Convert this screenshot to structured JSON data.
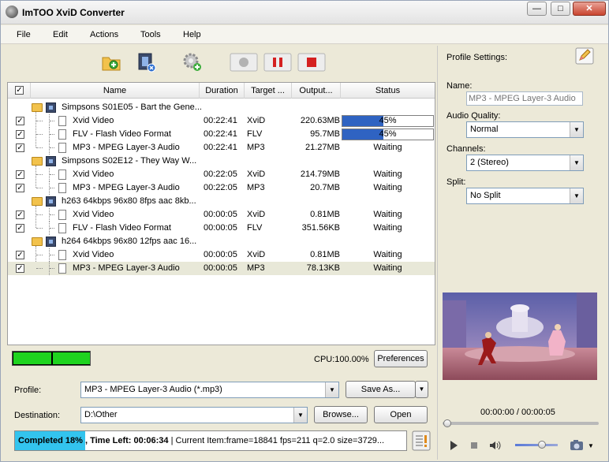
{
  "window": {
    "title": "ImTOO XviD Converter",
    "minimize": "—",
    "maximize": "□",
    "close": "✕"
  },
  "menu": [
    "File",
    "Edit",
    "Actions",
    "Tools",
    "Help"
  ],
  "table": {
    "headers": [
      "Name",
      "Duration",
      "Target ...",
      "Output...",
      "Status"
    ],
    "groups": [
      {
        "name": "Simpsons S01E05 - Bart the Gene...",
        "items": [
          {
            "name": "Xvid Video",
            "duration": "00:22:41",
            "target": "XviD",
            "output": "220.63MB",
            "status": "45%",
            "progress": 45
          },
          {
            "name": "FLV - Flash Video Format",
            "duration": "00:22:41",
            "target": "FLV",
            "output": "95.7MB",
            "status": "45%",
            "progress": 45
          },
          {
            "name": "MP3 - MPEG Layer-3 Audio",
            "duration": "00:22:41",
            "target": "MP3",
            "output": "21.27MB",
            "status": "Waiting"
          }
        ]
      },
      {
        "name": "Simpsons S02E12 - They Way W...",
        "items": [
          {
            "name": "Xvid Video",
            "duration": "00:22:05",
            "target": "XviD",
            "output": "214.79MB",
            "status": "Waiting"
          },
          {
            "name": "MP3 - MPEG Layer-3 Audio",
            "duration": "00:22:05",
            "target": "MP3",
            "output": "20.7MB",
            "status": "Waiting"
          }
        ]
      },
      {
        "name": "h263 64kbps 96x80 8fps aac 8kb...",
        "items": [
          {
            "name": "Xvid Video",
            "duration": "00:00:05",
            "target": "XviD",
            "output": "0.81MB",
            "status": "Waiting"
          },
          {
            "name": "FLV - Flash Video Format",
            "duration": "00:00:05",
            "target": "FLV",
            "output": "351.56KB",
            "status": "Waiting"
          }
        ]
      },
      {
        "name": "h264 64kbps 96x80 12fps aac 16...",
        "items": [
          {
            "name": "Xvid Video",
            "duration": "00:00:05",
            "target": "XviD",
            "output": "0.81MB",
            "status": "Waiting"
          },
          {
            "name": "MP3 - MPEG Layer-3 Audio",
            "duration": "00:00:05",
            "target": "MP3",
            "output": "78.13KB",
            "status": "Waiting",
            "selected": true
          }
        ]
      }
    ]
  },
  "cpu": {
    "label": "CPU:100.00%"
  },
  "buttons": {
    "preferences": "Preferences",
    "save_as": "Save As...",
    "browse": "Browse...",
    "open": "Open"
  },
  "profile": {
    "label": "Profile:",
    "value": "MP3 - MPEG Layer-3 Audio (*.mp3)"
  },
  "destination": {
    "label": "Destination:",
    "value": "D:\\Other"
  },
  "status_bar": {
    "progress": 18,
    "completed": "Completed 18%",
    "time_left": " , Time Left: 00:06:34",
    "current": " | Current Item:frame=18841 fps=211 q=2.0 size=3729..."
  },
  "profile_settings": {
    "title": "Profile Settings:",
    "name_label": "Name:",
    "name_placeholder": "MP3 - MPEG Layer-3 Audio",
    "audio_quality_label": "Audio Quality:",
    "audio_quality": "Normal",
    "channels_label": "Channels:",
    "channels": "2 (Stereo)",
    "split_label": "Split:",
    "split": "No Split"
  },
  "player": {
    "time": "00:00:00 / 00:00:05"
  }
}
